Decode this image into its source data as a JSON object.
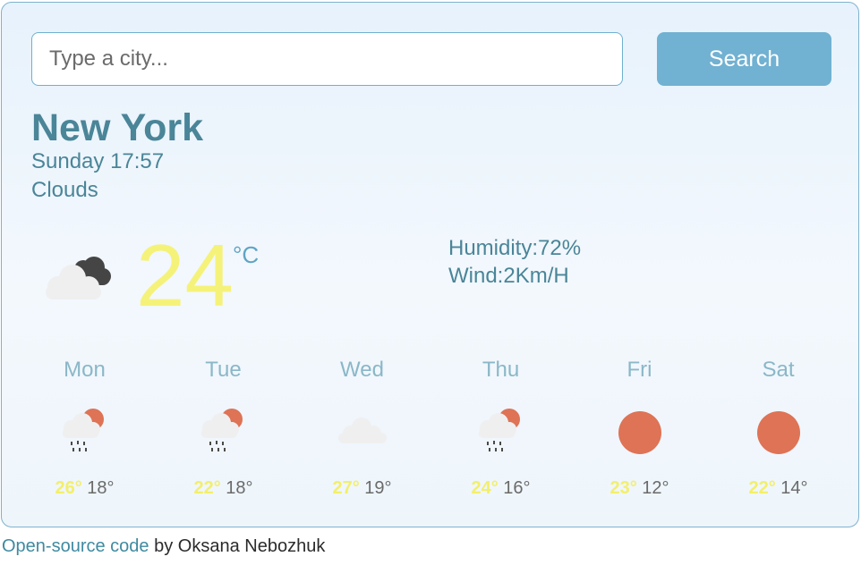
{
  "search": {
    "placeholder": "Type a city...",
    "value": "",
    "button_label": "Search"
  },
  "current": {
    "city": "New York",
    "datetime": "Sunday 17:57",
    "description": "Clouds",
    "icon": "cloudy-dark-cloud-icon",
    "temperature": "24",
    "unit": "°C",
    "humidity": "Humidity:72%",
    "wind": "Wind:2Km/H"
  },
  "forecast": [
    {
      "day": "Mon",
      "icon": "rain-sun-cloud-icon",
      "max": "26°",
      "min": "18°"
    },
    {
      "day": "Tue",
      "icon": "rain-sun-cloud-icon",
      "max": "22°",
      "min": "18°"
    },
    {
      "day": "Wed",
      "icon": "cloud-icon",
      "max": "27°",
      "min": "19°"
    },
    {
      "day": "Thu",
      "icon": "rain-sun-cloud-icon",
      "max": "24°",
      "min": "16°"
    },
    {
      "day": "Fri",
      "icon": "sun-icon",
      "max": "23°",
      "min": "12°"
    },
    {
      "day": "Sat",
      "icon": "sun-icon",
      "max": "22°",
      "min": "14°"
    }
  ],
  "footer": {
    "link_text": "Open-source code",
    "suffix": " by Oksana Nebozhuk"
  },
  "colors": {
    "accent": "#71b1d2",
    "text": "#4a8598",
    "temperature": "#f5f27a",
    "sun": "#de7356"
  }
}
